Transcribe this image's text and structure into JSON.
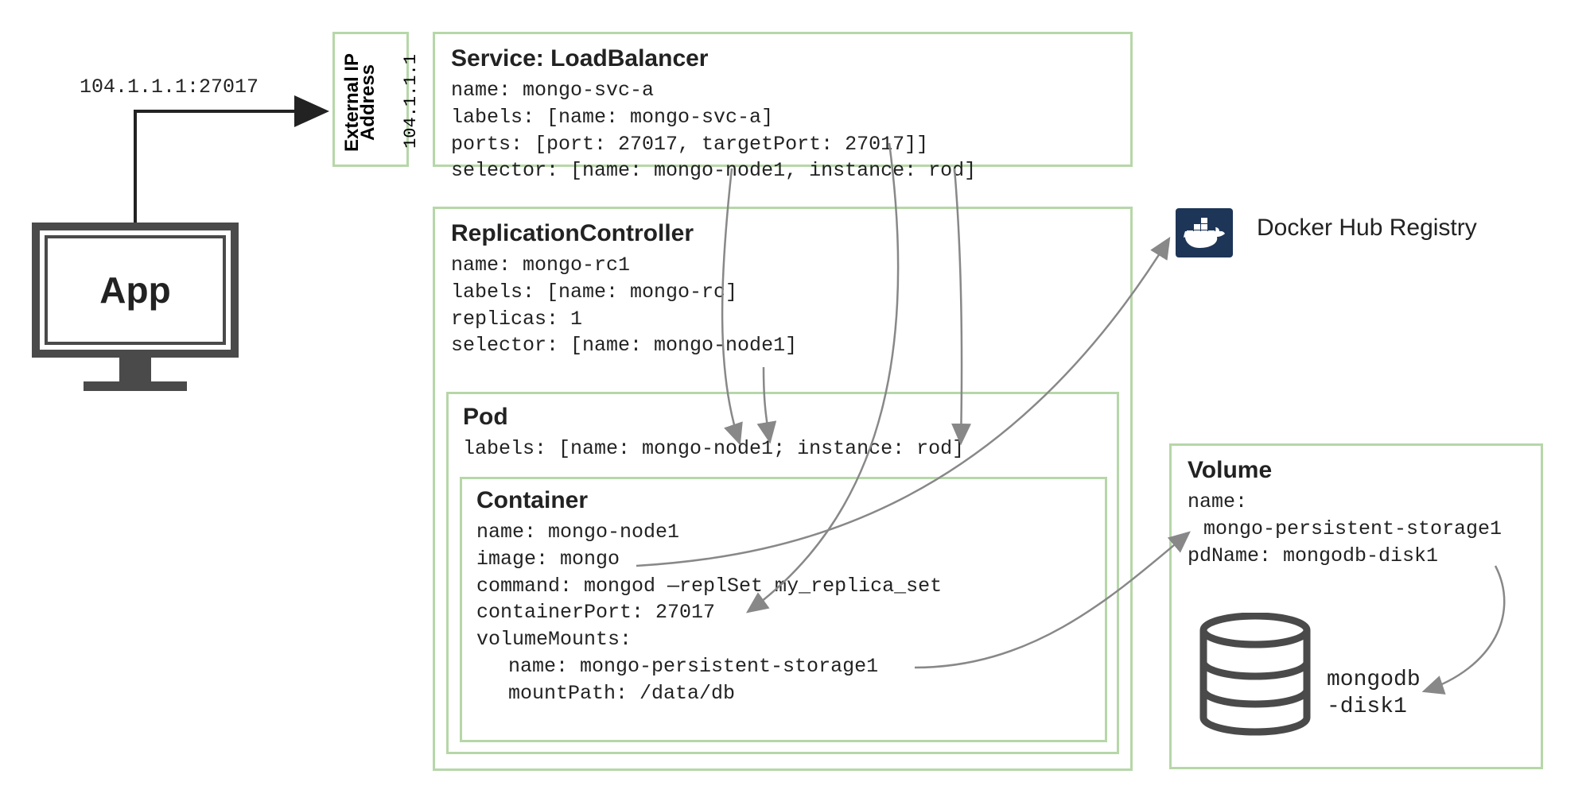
{
  "app": {
    "label": "App"
  },
  "ip_target": "104.1.1.1:27017",
  "external_ip": {
    "line1": "External IP",
    "line2": "Address",
    "addr": "104.1.1.1"
  },
  "service": {
    "title": "Service: LoadBalancer",
    "name": "name: mongo-svc-a",
    "labels": "labels: [name: mongo-svc-a]",
    "ports": "ports: [port: 27017, targetPort: 27017]]",
    "selector": "selector: [name: mongo-node1, instance: rod]"
  },
  "rc": {
    "title": "ReplicationController",
    "name": "name: mongo-rc1",
    "labels": "labels: [name: mongo-rc]",
    "replicas": "replicas: 1",
    "selector": "selector: [name: mongo-node1]"
  },
  "pod": {
    "title": "Pod",
    "labels": "labels: [name: mongo-node1; instance: rod]"
  },
  "container": {
    "title": "Container",
    "name": "name: mongo-node1",
    "image": "image: mongo",
    "command": "command: mongod —replSet my_replica_set",
    "port": "containerPort: 27017",
    "vm": "volumeMounts:",
    "vm_name": "name: mongo-persistent-storage1",
    "vm_path": "mountPath: /data/db"
  },
  "docker": {
    "label": "Docker Hub Registry"
  },
  "volume": {
    "title": "Volume",
    "name_lbl": "name:",
    "name_val": "mongo-persistent-storage1",
    "pd": "pdName: mongodb-disk1",
    "disk_lbl1": "mongodb",
    "disk_lbl2": "-disk1"
  }
}
